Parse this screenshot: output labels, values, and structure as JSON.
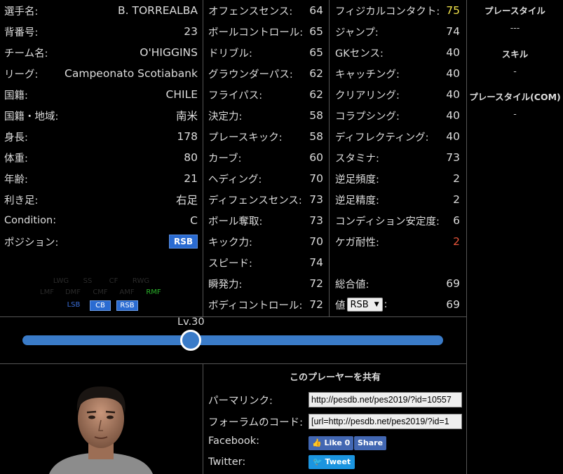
{
  "profile": [
    {
      "label": "選手名:",
      "value": "B. TORREALBA"
    },
    {
      "label": "背番号:",
      "value": "23"
    },
    {
      "label": "チーム名:",
      "value": "O'HIGGINS"
    },
    {
      "label": "リーグ:",
      "value": "Campeonato Scotiabank"
    },
    {
      "label": "国籍:",
      "value": "CHILE"
    },
    {
      "label": "国籍・地域:",
      "value": "南米"
    },
    {
      "label": "身長:",
      "value": "178"
    },
    {
      "label": "体重:",
      "value": "80"
    },
    {
      "label": "年齢:",
      "value": "21"
    },
    {
      "label": "利き足:",
      "value": "右足"
    },
    {
      "label": "Condition:",
      "value": "C"
    },
    {
      "label": "ポジション:",
      "value": "RSB"
    }
  ],
  "position_map": {
    "row1": [
      "LWG",
      "SS",
      "CF",
      "RWG"
    ],
    "row2": [
      "LMF",
      "DMF",
      "CMF",
      "AMF",
      "RMF"
    ],
    "row3": [
      "LSB",
      "CB",
      "RSB"
    ]
  },
  "attrs_mid": [
    {
      "label": "オフェンスセンス:",
      "value": "64"
    },
    {
      "label": "ボールコントロール:",
      "value": "65"
    },
    {
      "label": "ドリブル:",
      "value": "65"
    },
    {
      "label": "グラウンダーパス:",
      "value": "62"
    },
    {
      "label": "フライパス:",
      "value": "62"
    },
    {
      "label": "決定力:",
      "value": "58"
    },
    {
      "label": "プレースキック:",
      "value": "58"
    },
    {
      "label": "カーブ:",
      "value": "60"
    },
    {
      "label": "ヘディング:",
      "value": "70"
    },
    {
      "label": "ディフェンスセンス:",
      "value": "73"
    },
    {
      "label": "ボール奪取:",
      "value": "73"
    },
    {
      "label": "キック力:",
      "value": "70"
    },
    {
      "label": "スピード:",
      "value": "74"
    },
    {
      "label": "瞬発力:",
      "value": "72"
    },
    {
      "label": "ボディコントロール:",
      "value": "72"
    }
  ],
  "attrs_right": [
    {
      "label": "フィジカルコンタクト:",
      "value": "75"
    },
    {
      "label": "ジャンプ:",
      "value": "74"
    },
    {
      "label": "GKセンス:",
      "value": "40"
    },
    {
      "label": "キャッチング:",
      "value": "40"
    },
    {
      "label": "クリアリング:",
      "value": "40"
    },
    {
      "label": "コラプシング:",
      "value": "40"
    },
    {
      "label": "ディフレクティング:",
      "value": "40"
    },
    {
      "label": "スタミナ:",
      "value": "73"
    },
    {
      "label": "逆足頻度:",
      "value": "2"
    },
    {
      "label": "逆足精度:",
      "value": "2"
    },
    {
      "label": "コンディション安定度:",
      "value": "6"
    },
    {
      "label": "ケガ耐性:",
      "value": "2"
    }
  ],
  "totals": {
    "overall_label": "総合値:",
    "overall_value": "69",
    "value_label": "値",
    "value_select": "RSB",
    "value_suffix": ":",
    "value_value": "69"
  },
  "sidebar": {
    "playstyle_title": "プレースタイル",
    "playstyle_value": "---",
    "skill_title": "スキル",
    "skill_value": "-",
    "com_title": "プレースタイル(COM)",
    "com_value": "-"
  },
  "level": {
    "label": "Lv.30",
    "fraction": 0.4
  },
  "share": {
    "title": "このプレーヤーを共有",
    "permalink_label": "パーマリンク:",
    "permalink_value": "http://pesdb.net/pes2019/?id=10557",
    "forum_label": "フォーラムのコード:",
    "forum_value": "[url=http://pesdb.net/pes2019/?id=1",
    "facebook_label": "Facebook:",
    "like_label": "Like 0",
    "share_label": "Share",
    "twitter_label": "Twitter:",
    "tweet_label": "Tweet"
  },
  "colors": {
    "highlight_yellow": "#f2e34a",
    "highlight_red": "#e8553b",
    "accent_blue": "#3a7bc8",
    "badge_blue": "#2a6bd1"
  }
}
